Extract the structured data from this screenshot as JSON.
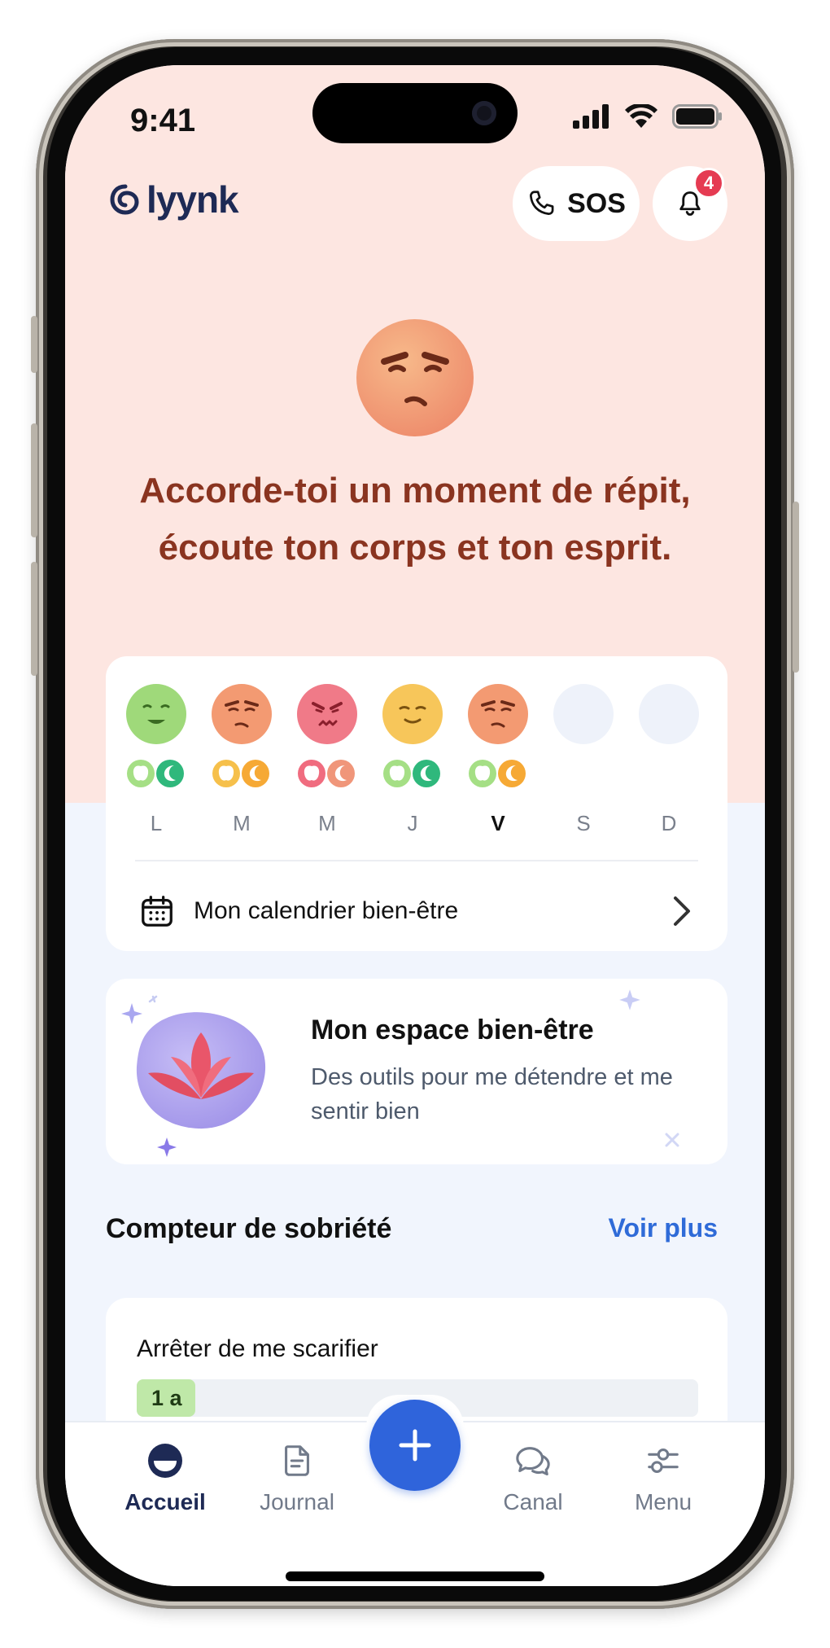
{
  "status_bar": {
    "time": "9:41"
  },
  "header": {
    "logo_text": "lyynk",
    "sos_label": "SOS",
    "notification_count": "4"
  },
  "hero": {
    "mood": "frustrated",
    "message_line1": "Accorde-toi un moment de répit,",
    "message_line2": "écoute ton corps et ton esprit."
  },
  "week": {
    "days": [
      {
        "letter": "L",
        "mood": "happy",
        "color": "#9fd97a",
        "meal": "green",
        "sleep": "green"
      },
      {
        "letter": "M",
        "mood": "frustrated",
        "color": "#f39a72",
        "meal": "orange",
        "sleep": "orange"
      },
      {
        "letter": "M",
        "mood": "angry",
        "color": "#f07a88",
        "meal": "red",
        "sleep": "red"
      },
      {
        "letter": "J",
        "mood": "content",
        "color": "#f7c65a",
        "meal": "green",
        "sleep": "green"
      },
      {
        "letter": "V",
        "mood": "frustrated",
        "color": "#f39a72",
        "meal": "green",
        "sleep": "orange",
        "current": true
      },
      {
        "letter": "S",
        "mood": "empty",
        "color": "#eef2fa"
      },
      {
        "letter": "D",
        "mood": "empty",
        "color": "#eef2fa"
      }
    ],
    "calendar_label": "Mon calendrier bien-être"
  },
  "wellbeing": {
    "title": "Mon espace bien-être",
    "subtitle": "Des outils pour me détendre et me sentir bien"
  },
  "sobriety": {
    "section_title": "Compteur de sobriété",
    "see_more": "Voir plus",
    "goal": "Arrêter de me scarifier",
    "duration": "1 a"
  },
  "nav": {
    "home": "Accueil",
    "journal": "Journal",
    "channel": "Canal",
    "menu": "Menu"
  },
  "colors": {
    "accent": "#2f64db",
    "hero_text": "#8a3420",
    "pink_bg": "#fde6e1",
    "page_bg": "#f1f5fd"
  }
}
